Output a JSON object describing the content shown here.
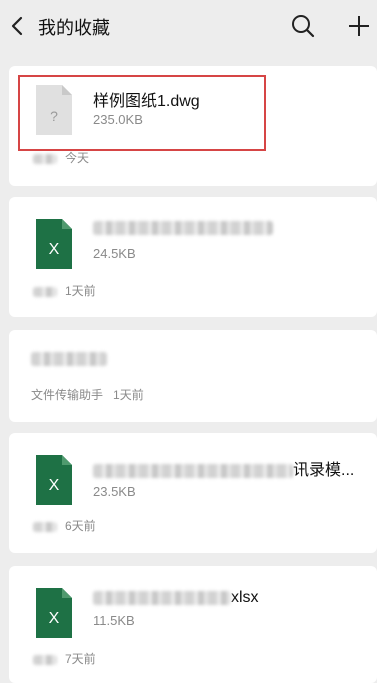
{
  "header": {
    "title": "我的收藏"
  },
  "colors": {
    "excel_green": "#1e7145",
    "highlight": "#d64545"
  },
  "items": [
    {
      "icon": "unknown-file-icon",
      "name": "样例图纸1.dwg",
      "size": "235.0KB",
      "time": "今天"
    },
    {
      "icon": "excel-icon",
      "name": "",
      "size": "24.5KB",
      "time": "1天前"
    },
    {
      "source": "文件传输助手",
      "time": "1天前"
    },
    {
      "icon": "excel-icon",
      "name_suffix": "讯录模...",
      "size": "23.5KB",
      "time": "6天前"
    },
    {
      "icon": "excel-icon",
      "name_suffix": "xlsx",
      "size": "11.5KB",
      "time": "7天前"
    }
  ]
}
